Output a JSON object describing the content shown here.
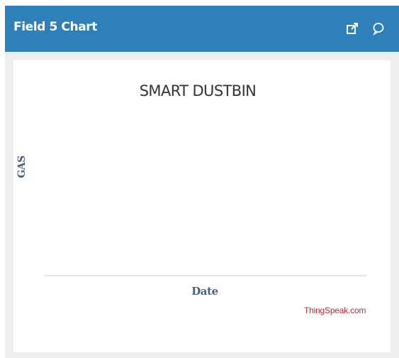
{
  "header": {
    "title": "Field 5 Chart",
    "icons": [
      "popout-icon",
      "comment-icon"
    ]
  },
  "chart_data": {
    "type": "line",
    "title": "SMART DUSTBIN",
    "xlabel": "Date",
    "ylabel": "GAS",
    "series": [],
    "credit": "ThingSpeak.com"
  },
  "colors": {
    "header_bg": "#2e80b9",
    "axis_line": "#c0d0e0",
    "credit": "#c0272d",
    "label": "#4d5f7f"
  }
}
